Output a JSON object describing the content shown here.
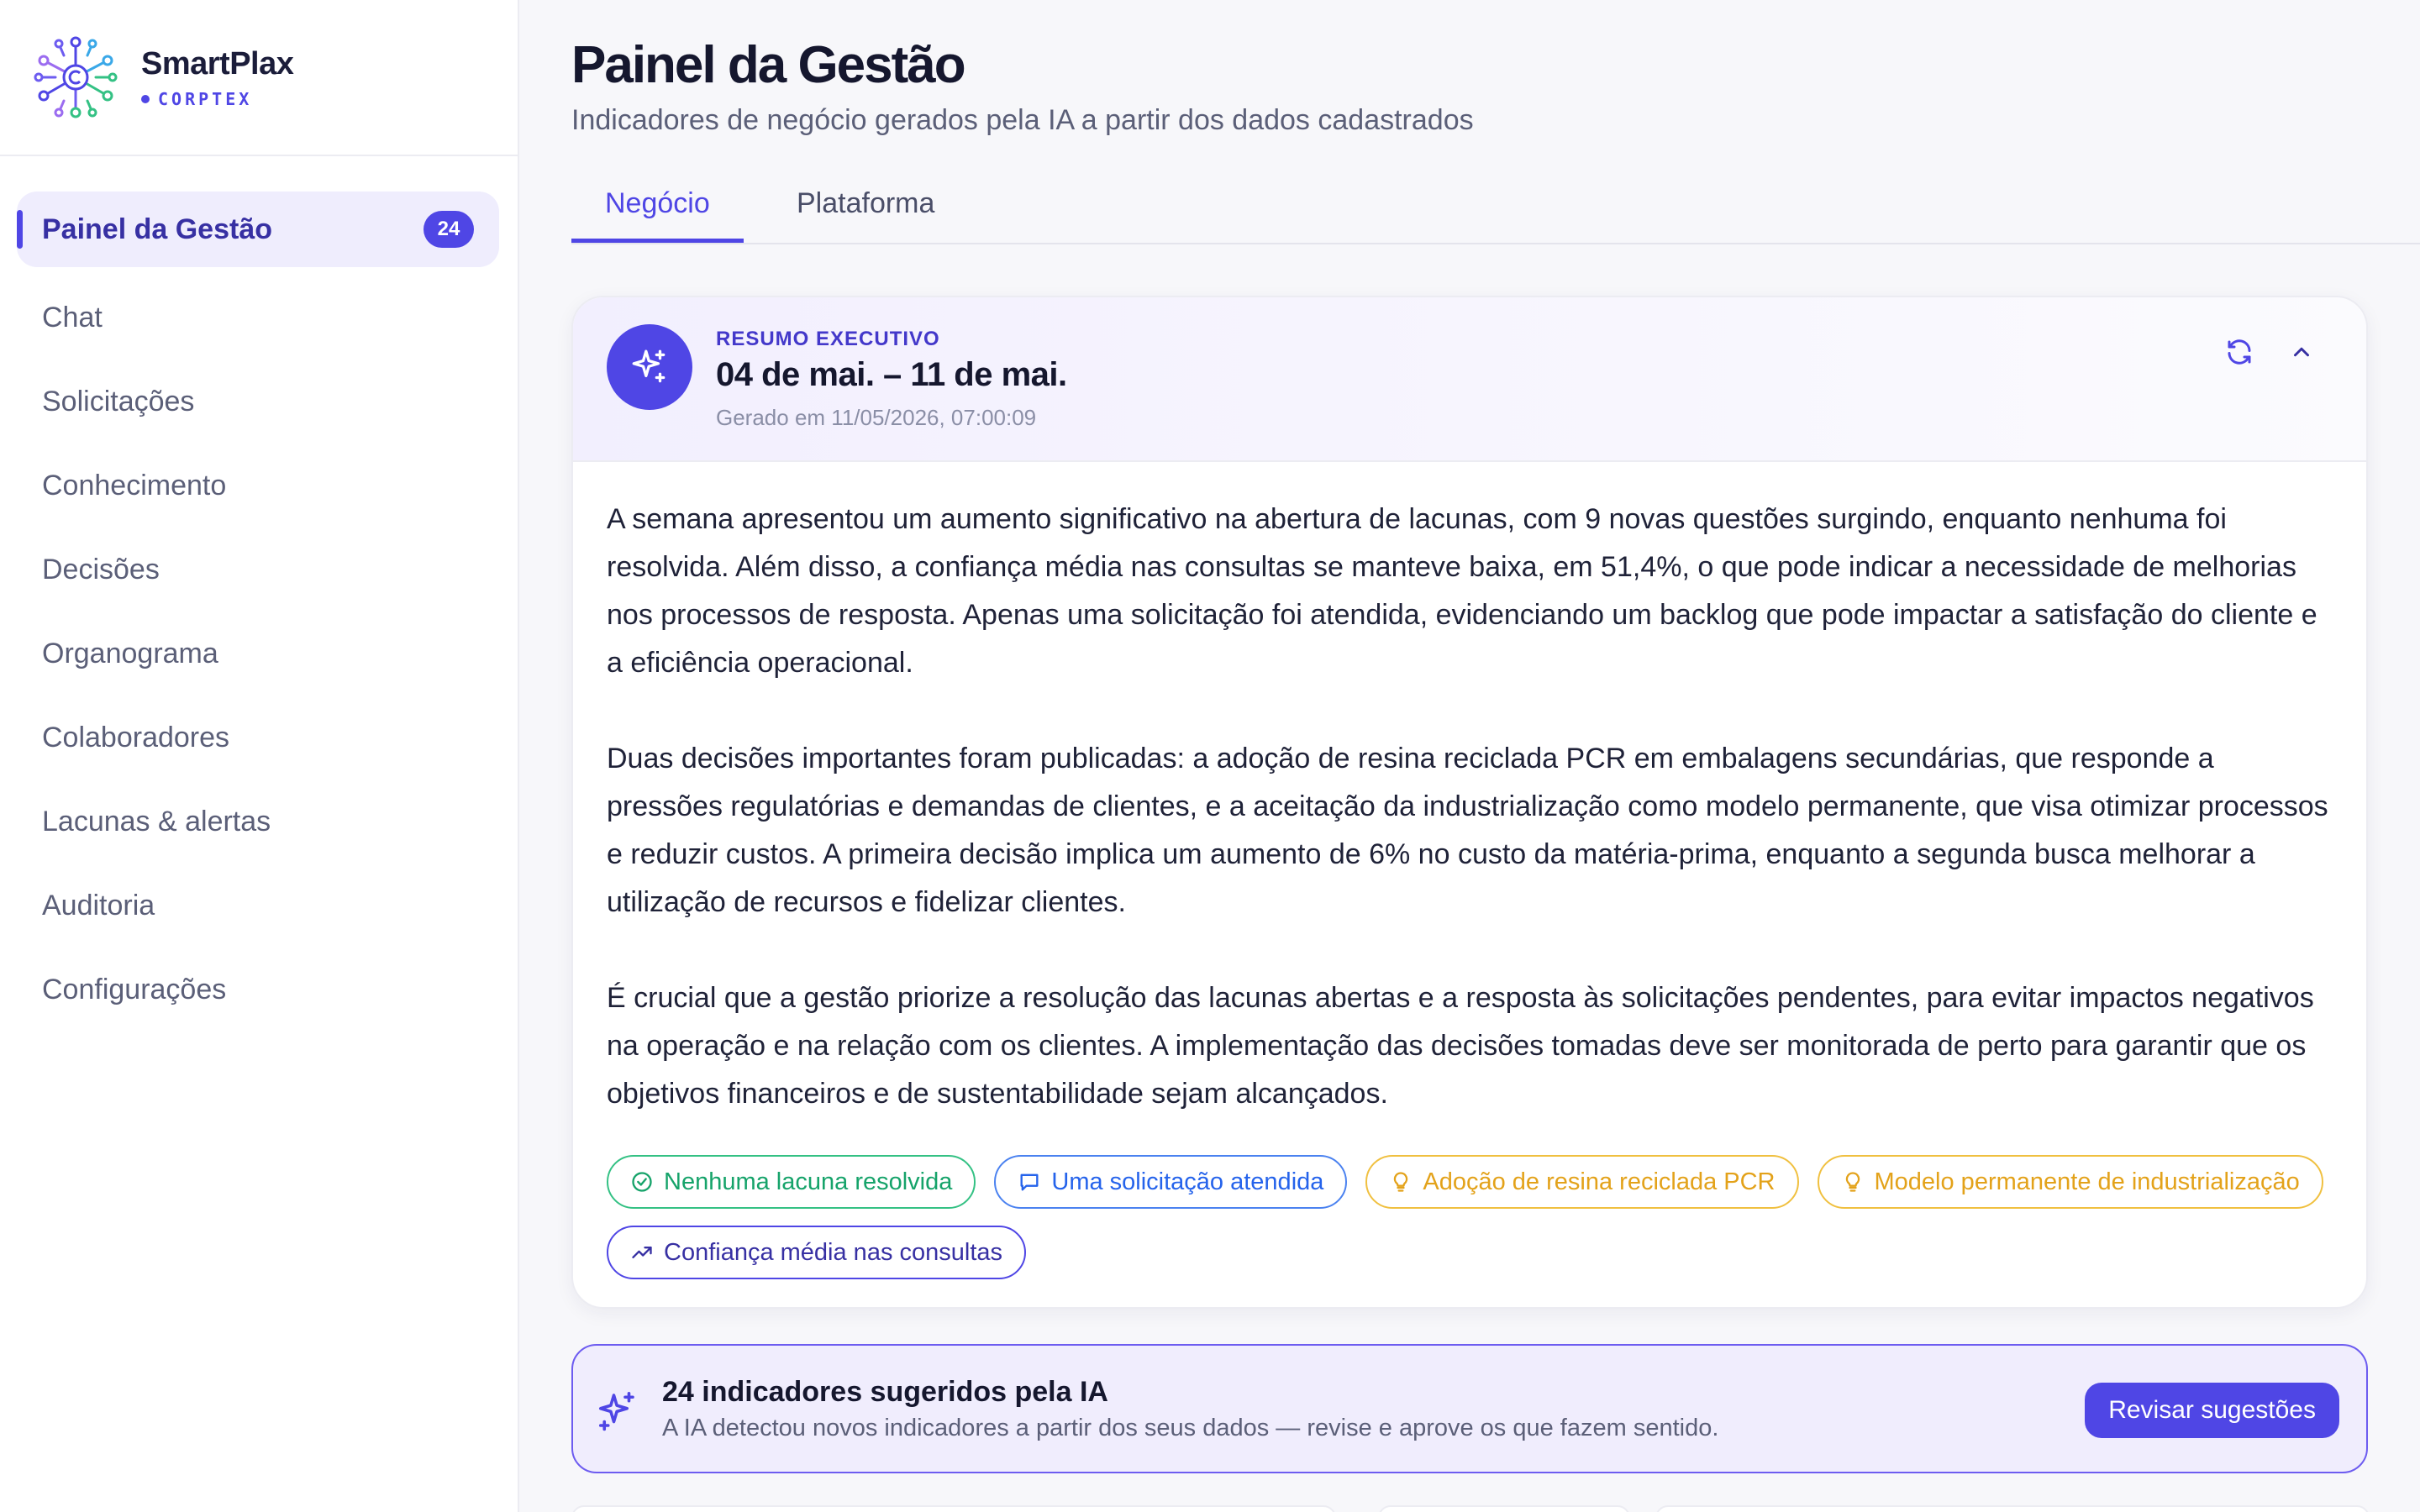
{
  "brand": {
    "name": "SmartPlax",
    "sub": "CORPTEX"
  },
  "sidebar": {
    "items": [
      {
        "label": "Painel da Gestão",
        "badge": "24"
      },
      {
        "label": "Chat"
      },
      {
        "label": "Solicitações"
      },
      {
        "label": "Conhecimento"
      },
      {
        "label": "Decisões"
      },
      {
        "label": "Organograma"
      },
      {
        "label": "Colaboradores"
      },
      {
        "label": "Lacunas & alertas"
      },
      {
        "label": "Auditoria"
      },
      {
        "label": "Configurações"
      }
    ]
  },
  "header": {
    "title": "Painel da Gestão",
    "subtitle": "Indicadores de negócio gerados pela IA a partir dos dados cadastrados"
  },
  "tabs": [
    {
      "label": "Negócio",
      "active": true
    },
    {
      "label": "Plataforma",
      "active": false
    }
  ],
  "summary": {
    "label": "RESUMO EXECUTIVO",
    "period": "04 de mai. – 11 de mai.",
    "generated": "Gerado em 11/05/2026, 07:00:09",
    "paragraphs": [
      "A semana apresentou um aumento significativo na abertura de lacunas, com 9 novas questões surgindo, enquanto nenhuma foi resolvida. Além disso, a confiança média nas consultas se manteve baixa, em 51,4%, o que pode indicar a necessidade de melhorias nos processos de resposta. Apenas uma solicitação foi atendida, evidenciando um backlog que pode impactar a satisfação do cliente e a eficiência operacional.",
      "Duas decisões importantes foram publicadas: a adoção de resina reciclada PCR em embalagens secundárias, que responde a pressões regulatórias e demandas de clientes, e a aceitação da industrialização como modelo permanente, que visa otimizar processos e reduzir custos. A primeira decisão implica um aumento de 6% no custo da matéria-prima, enquanto a segunda busca melhorar a utilização de recursos e fidelizar clientes.",
      "É crucial que a gestão priorize a resolução das lacunas abertas e a resposta às solicitações pendentes, para evitar impactos negativos na operação e na relação com os clientes. A implementação das decisões tomadas deve ser monitorada de perto para garantir que os objetivos financeiros e de sustentabilidade sejam alcançados."
    ],
    "chips": [
      {
        "label": "Nenhuma lacuna resolvida",
        "icon": "check-circle-icon",
        "color": "#16a36a"
      },
      {
        "label": "Uma solicitação atendida",
        "icon": "message-icon",
        "color": "#2563eb"
      },
      {
        "label": "Adoção de resina reciclada PCR",
        "icon": "lightbulb-icon",
        "color": "#e3a21a"
      },
      {
        "label": "Modelo permanente de industrialização",
        "icon": "lightbulb-icon",
        "color": "#e3a21a"
      },
      {
        "label": "Confiança média nas consultas",
        "icon": "trend-up-icon",
        "color": "#3730a3"
      }
    ]
  },
  "suggestions": {
    "title": "24 indicadores sugeridos pela IA",
    "subtitle": "A IA detectou novos indicadores a partir dos seus dados — revise e aprove os que fazem sentido.",
    "button": "Revisar sugestões"
  },
  "colors": {
    "accent": "#4f46e5",
    "accent_dark": "#3730a3",
    "green": "#16a36a",
    "blue": "#2563eb",
    "amber": "#e3a21a"
  }
}
